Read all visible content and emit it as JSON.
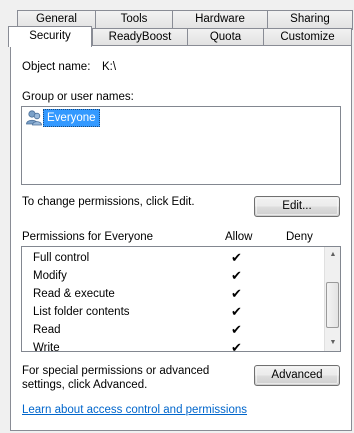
{
  "tabs_back": [
    "General",
    "Tools",
    "Hardware",
    "Sharing"
  ],
  "tabs_front": [
    "Security",
    "ReadyBoost",
    "Quota",
    "Customize"
  ],
  "object_name_label": "Object name:",
  "object_name_value": "K:\\",
  "group_label": "Group or user names:",
  "groups": [
    {
      "name": "Everyone",
      "icon": "users-icon",
      "selected": true
    }
  ],
  "change_text": "To change permissions, click Edit.",
  "edit_button": "Edit...",
  "permissions_label": "Permissions for Everyone",
  "allow_header": "Allow",
  "deny_header": "Deny",
  "permissions": [
    {
      "name": "Full control",
      "allow": true,
      "deny": false
    },
    {
      "name": "Modify",
      "allow": true,
      "deny": false
    },
    {
      "name": "Read & execute",
      "allow": true,
      "deny": false
    },
    {
      "name": "List folder contents",
      "allow": true,
      "deny": false
    },
    {
      "name": "Read",
      "allow": true,
      "deny": false
    },
    {
      "name": "Write",
      "allow": true,
      "deny": false
    }
  ],
  "advanced_text": "For special permissions or advanced settings, click Advanced.",
  "advanced_button": "Advanced",
  "link_text": "Learn about access control and permissions",
  "colors": {
    "selection": "#3399ff",
    "link": "#0066cc",
    "window_bg": "#f0f0f0"
  }
}
